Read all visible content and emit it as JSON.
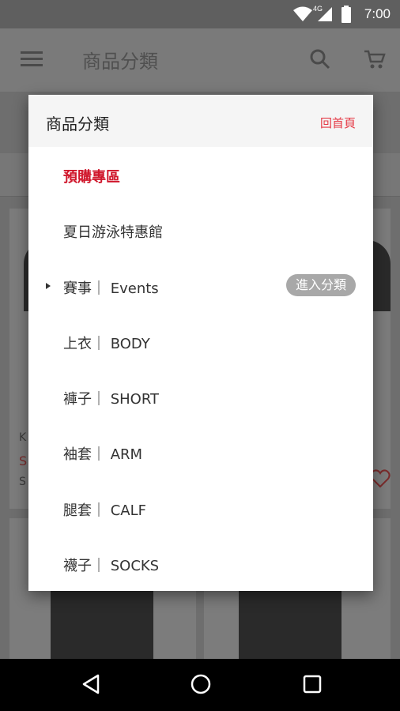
{
  "status_bar": {
    "network": "4G",
    "time": "7:00",
    "icons": [
      "wifi-icon",
      "signal-icon",
      "battery-icon"
    ]
  },
  "app_bar": {
    "title": "商品分類",
    "icons": [
      "menu-icon",
      "search-icon",
      "cart-icon"
    ]
  },
  "dialog": {
    "title": "商品分類",
    "home_link": "回首頁",
    "items": [
      {
        "label": "預購專區",
        "highlight": true
      },
      {
        "label": "夏日游泳特惠館"
      },
      {
        "label": "賽事｜ Events",
        "expandable": true,
        "badge": "進入分類"
      },
      {
        "label": "上衣｜ BODY"
      },
      {
        "label": "褲子｜ SHORT"
      },
      {
        "label": "袖套｜ ARM"
      },
      {
        "label": "腿套｜ CALF"
      },
      {
        "label": "襪子｜ SOCKS"
      }
    ]
  },
  "background_cards": {
    "visible_text": [
      "K",
      "S",
      "S"
    ]
  },
  "nav_bar": {
    "icons": [
      "back-icon",
      "home-icon",
      "recents-icon"
    ]
  },
  "colors": {
    "accent_red": "#d0172c",
    "link_red": "#e53945",
    "badge_gray": "#a8a8a8",
    "scrim": "#6e6e6e"
  }
}
